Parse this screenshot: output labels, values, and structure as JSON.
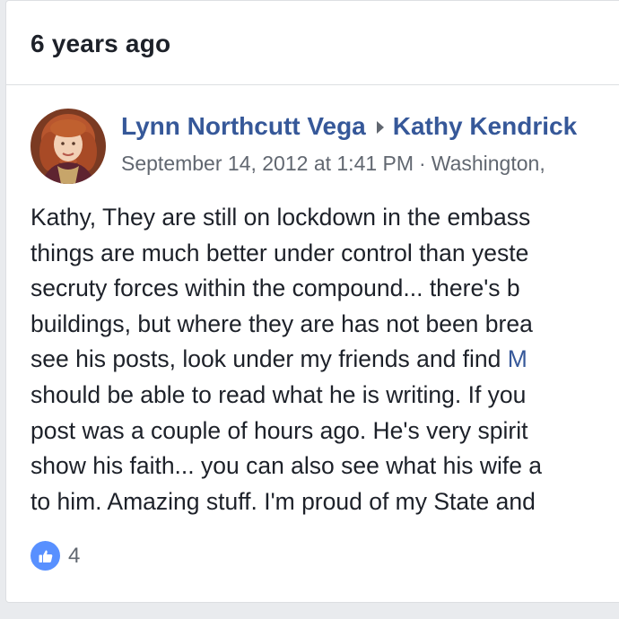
{
  "card": {
    "title": "6 years ago"
  },
  "post": {
    "author": "Lynn Northcutt Vega",
    "recipient": "Kathy Kendrick",
    "timestamp": "September 14, 2012 at 1:41 PM",
    "separator": "·",
    "location": "Washington,",
    "body_lines": [
      {
        "text": "Kathy, They are still on lockdown in the embass"
      },
      {
        "text": "things are much better under control than yeste"
      },
      {
        "text": "secruty forces within the compound... there's b"
      },
      {
        "text": "buildings, but where they are has not been brea"
      },
      {
        "text": "see his posts, look under my friends and find ",
        "mention": "M"
      },
      {
        "text": "should be able to read what he is writing. If you"
      },
      {
        "text": "post was a couple of hours ago. He's very spirit"
      },
      {
        "text": "show his faith... you can also see what his wife a"
      },
      {
        "text": "to him. Amazing stuff. I'm proud of my State and"
      }
    ]
  },
  "reactions": {
    "icon": "like-icon",
    "count": "4"
  },
  "colors": {
    "link": "#365899",
    "text": "#1d2129",
    "meta": "#616770",
    "like": "#5890ff",
    "background": "#e9ebee"
  }
}
